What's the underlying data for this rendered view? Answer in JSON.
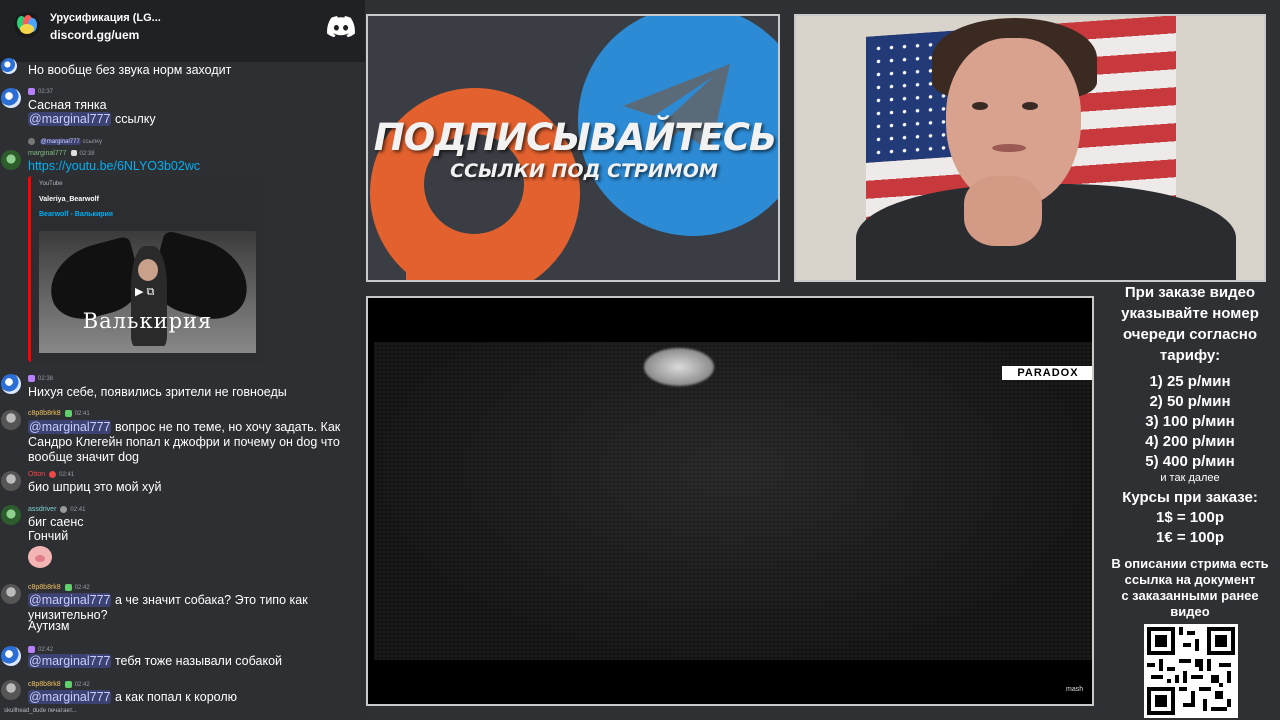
{
  "chat_header": {
    "server_name": "Урусификация (LG...",
    "server_link": "discord.gg/uem"
  },
  "messages": [
    {
      "time": "",
      "text": "Но вообще без звука норм заходит"
    },
    {
      "time": "02:37",
      "text": "Сасная тянка"
    },
    {
      "time": "",
      "mention": "@marginal777",
      "text": " ссылку"
    },
    {
      "reply_mention": "@marginal777",
      "reply_text": "ссылку",
      "nick": "marginal777",
      "time": "02:38",
      "link": "https://youtu.be/6NLYO3b02wc"
    },
    {
      "time": "02:38",
      "text": "Нихуя себе, появились зрители не говноеды"
    },
    {
      "nick": "c8p8b8rk8",
      "time": "02:41",
      "mention": "@marginal777",
      "text": " вопрос не по теме, но хочу задать. Как Сандро Клегейн попал к джофри и почему он dog что вообще значит dog"
    },
    {
      "nick": "Otton",
      "time": "02:41",
      "text": "био шприц это мой хуй"
    },
    {
      "nick": "assdriver",
      "time": "02:41",
      "text": "биг саенс",
      "text2": "Гончий"
    },
    {
      "nick": "c8p8b8rk8",
      "time": "02:42",
      "mention": "@marginal777",
      "text": " а че значит собака? Это типо как унизительно?",
      "text2": "Аутизм"
    },
    {
      "time": "02:42",
      "mention": "@marginal777",
      "text": " тебя тоже называли собакой"
    },
    {
      "nick": "c8p8b8rk8",
      "time": "02:42",
      "mention": "@marginal777",
      "text": " а как попал к королю"
    }
  ],
  "embed": {
    "provider": "YouTube",
    "author": "Valeriya_Bearwolf",
    "video_title": "Bearwolf - Валькирия",
    "thumb_title": "Валькирия"
  },
  "typing": "skullhead_dude печатает...",
  "promo": {
    "headline": "ПОДПИСЫВАЙТЕСЬ",
    "subline": "ССЫЛКИ ПОД СТРИМОМ"
  },
  "video": {
    "watermark": "PARADOX",
    "source": "mash"
  },
  "info": {
    "intro": [
      "При заказе видео",
      "указывайте номер",
      "очереди согласно",
      "тарифу:"
    ],
    "tariffs": [
      "1) 25 р/мин",
      "2) 50 р/мин",
      "3) 100 р/мин",
      "4) 200 р/мин",
      "5) 400 р/мин"
    ],
    "etc": "и так далее",
    "rates_title": "Курсы при заказе:",
    "rates": [
      "1$ = 100р",
      "1€ = 100р"
    ],
    "desc": [
      "В описании стрима есть",
      "ссылка на документ",
      "с заказанными ранее",
      "видео"
    ]
  },
  "colors": {
    "discord_blurple": "#5865f2",
    "mention_bg": "#3c4272",
    "link": "#00aff4",
    "panel_border": "#c9c9c9"
  }
}
